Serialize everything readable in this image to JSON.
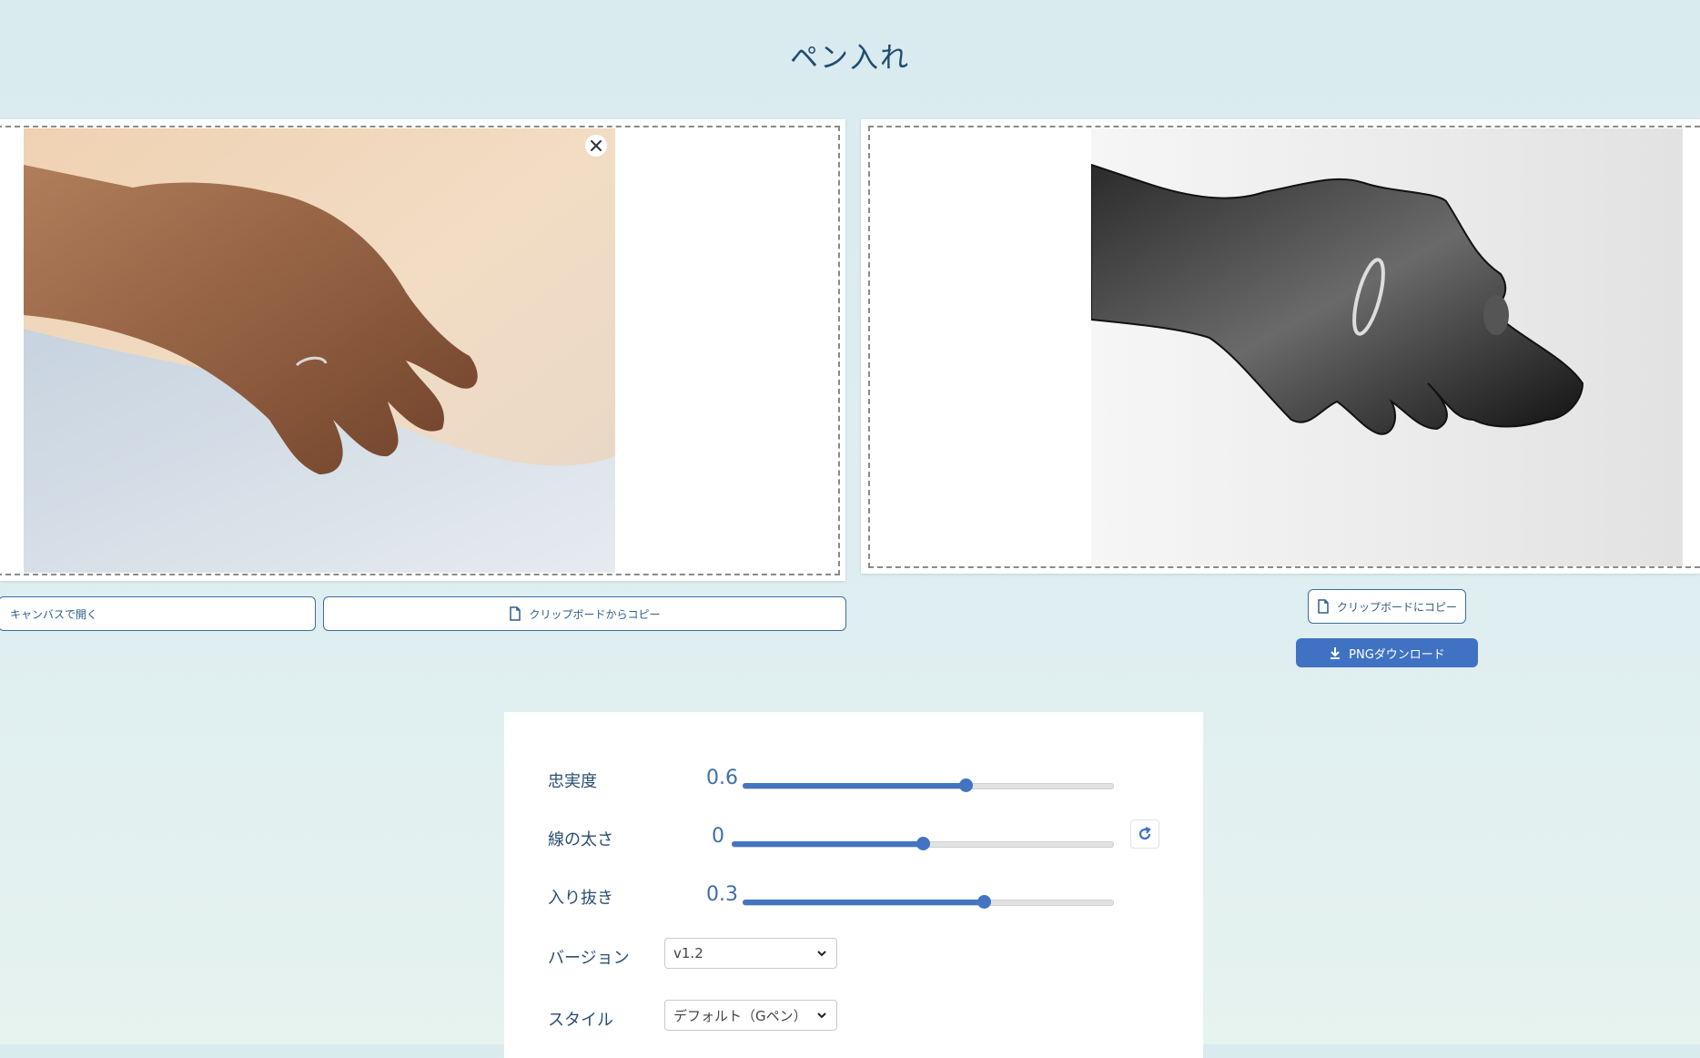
{
  "page": {
    "title": "ペン入れ"
  },
  "input_panel": {
    "open_canvas_label": "キャンバスで開く",
    "paste_label": "クリップボードからコピー"
  },
  "output_panel": {
    "copy_label": "クリップボードにコピー",
    "download_label": "PNGダウンロード"
  },
  "settings": {
    "fidelity": {
      "label": "忠実度",
      "value": "0.6",
      "fraction": 0.6
    },
    "line_width": {
      "label": "線の太さ",
      "value": "0",
      "fraction": 0.5
    },
    "taper": {
      "label": "入り抜き",
      "value": "0.3",
      "fraction": 0.65
    },
    "version": {
      "label": "バージョン",
      "selected": "v1.2"
    },
    "style": {
      "label": "スタイル",
      "selected": "デフォルト（Gペン）"
    }
  },
  "colors": {
    "accent": "#4374c2",
    "title": "#1f4d72",
    "background": "#dcedf0"
  }
}
